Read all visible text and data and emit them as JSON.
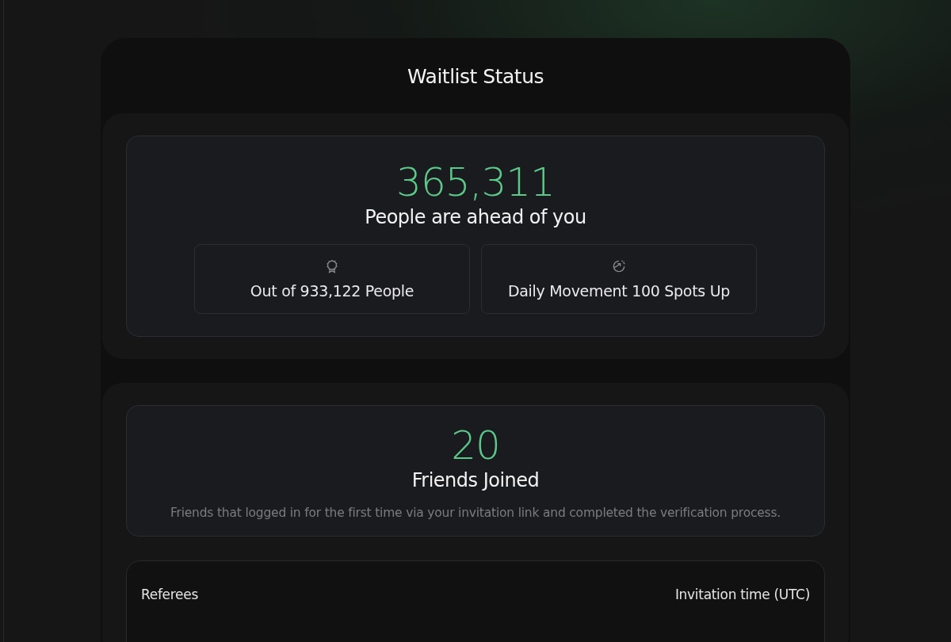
{
  "title": "Waitlist Status",
  "position": {
    "count": "365,311",
    "label": "People are ahead of you",
    "stats": [
      {
        "kind": "total",
        "text": "Out of 933,122 People"
      },
      {
        "kind": "movement",
        "text": "Daily Movement 100 Spots Up"
      }
    ]
  },
  "friends": {
    "count": "20",
    "label": "Friends Joined",
    "description": "Friends that logged in for the first time via your invitation link and completed the verification process."
  },
  "table": {
    "columns": [
      "Referees",
      "Invitation time (UTC)"
    ]
  }
}
